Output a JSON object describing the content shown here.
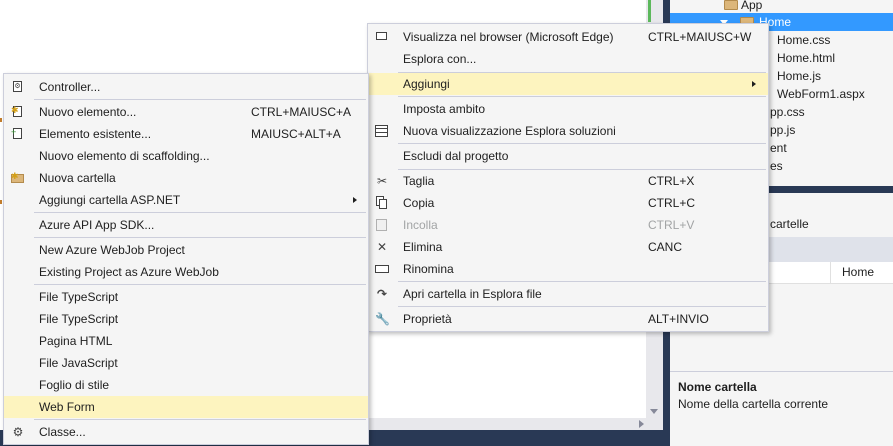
{
  "solution_explorer": {
    "items": [
      {
        "label": "App",
        "selected": false
      },
      {
        "label": "Home",
        "selected": true
      },
      {
        "label": "Home.css"
      },
      {
        "label": "Home.html"
      },
      {
        "label": "Home.js"
      },
      {
        "label": "WebForm1.aspx"
      },
      {
        "label": "pp.css"
      },
      {
        "label": "pp.js"
      },
      {
        "label": "ent"
      },
      {
        "label": "es"
      }
    ]
  },
  "properties": {
    "header_fragment": "cartelle",
    "row_value": "Home",
    "description_title": "Nome cartella",
    "description_text": "Nome della cartella corrente"
  },
  "main_menu": {
    "items": [
      {
        "label": "Visualizza nel browser (Microsoft Edge)",
        "shortcut": "CTRL+MAIUSC+W",
        "icon": "browser-icon"
      },
      {
        "label": "Esplora con...",
        "shortcut": ""
      },
      {
        "label": "Aggiungi",
        "shortcut": "",
        "submenu": true,
        "highlighted": true
      },
      {
        "label": "Imposta ambito",
        "shortcut": ""
      },
      {
        "label": "Nuova visualizzazione Esplora soluzioni",
        "shortcut": "",
        "icon": "new-view-icon"
      },
      {
        "label": "Escludi dal progetto",
        "shortcut": ""
      },
      {
        "label": "Taglia",
        "shortcut": "CTRL+X",
        "icon": "scissors-icon"
      },
      {
        "label": "Copia",
        "shortcut": "CTRL+C",
        "icon": "copy-icon"
      },
      {
        "label": "Incolla",
        "shortcut": "CTRL+V",
        "icon": "paste-icon",
        "disabled": true
      },
      {
        "label": "Elimina",
        "shortcut": "CANC",
        "icon": "delete-icon"
      },
      {
        "label": "Rinomina",
        "shortcut": "",
        "icon": "rename-icon"
      },
      {
        "label": "Apri cartella in Esplora file",
        "shortcut": "",
        "icon": "open-folder-arrow-icon"
      },
      {
        "label": "Proprietà",
        "shortcut": "ALT+INVIO",
        "icon": "wrench-icon"
      }
    ]
  },
  "add_submenu": {
    "items": [
      {
        "label": "Controller...",
        "shortcut": "",
        "icon": "controller-icon"
      },
      {
        "label": "Nuovo elemento...",
        "shortcut": "CTRL+MAIUSC+A",
        "icon": "new-item-icon"
      },
      {
        "label": "Elemento esistente...",
        "shortcut": "MAIUSC+ALT+A",
        "icon": "existing-item-icon"
      },
      {
        "label": "Nuovo elemento di scaffolding...",
        "shortcut": ""
      },
      {
        "label": "Nuova cartella",
        "shortcut": "",
        "icon": "new-folder-icon"
      },
      {
        "label": "Aggiungi cartella ASP.NET",
        "shortcut": "",
        "submenu": true
      },
      {
        "label": "Azure API App SDK...",
        "shortcut": ""
      },
      {
        "label": "New Azure WebJob Project",
        "shortcut": ""
      },
      {
        "label": "Existing Project as Azure WebJob",
        "shortcut": ""
      },
      {
        "label": "File TypeScript",
        "shortcut": ""
      },
      {
        "label": "File TypeScript",
        "shortcut": ""
      },
      {
        "label": "Pagina HTML",
        "shortcut": ""
      },
      {
        "label": "File JavaScript",
        "shortcut": ""
      },
      {
        "label": "Foglio di stile",
        "shortcut": ""
      },
      {
        "label": "Web Form",
        "shortcut": "",
        "highlighted": true
      },
      {
        "label": "Classe...",
        "shortcut": "",
        "icon": "class-icon"
      }
    ]
  }
}
